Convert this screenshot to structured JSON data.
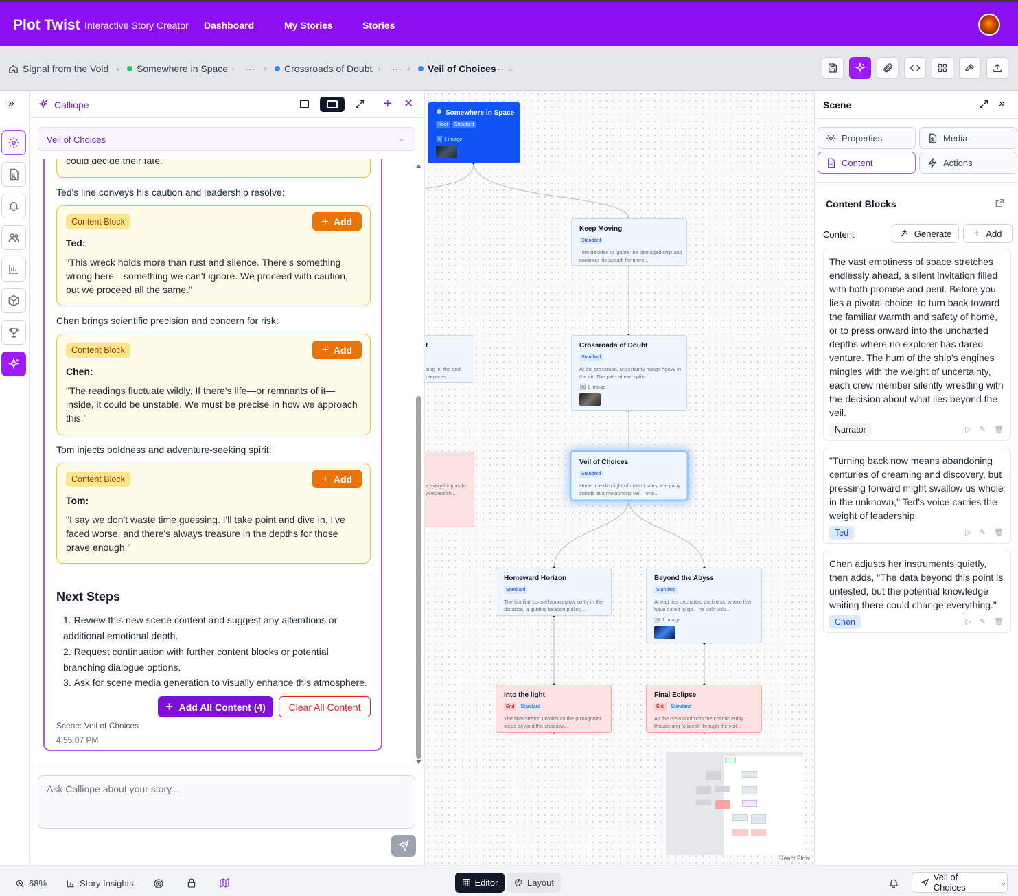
{
  "app": {
    "name": "Plot Twist",
    "tagline": "Interactive Story Creator",
    "nav": [
      "Dashboard",
      "My Stories",
      "Stories"
    ]
  },
  "breadcrumb": {
    "root": "Signal from the Void",
    "items": [
      "Somewhere in Space",
      "Crossroads of Doubt",
      "Veil of Choices"
    ],
    "ellipsis": "···"
  },
  "chat": {
    "title": "Calliope",
    "scene_select": "Veil of Choices",
    "cut_text": "could decide their fate.",
    "block_tag": "Content Block",
    "add_label": "Add",
    "blocks": [
      {
        "intro": "Ted's line conveys his caution and leadership resolve:",
        "name": "Ted:",
        "text": "\"This wreck holds more than rust and silence. There's something wrong here—something we can't ignore. We proceed with caution, but we proceed all the same.\""
      },
      {
        "intro": "Chen brings scientific precision and concern for risk:",
        "name": "Chen:",
        "text": "\"The readings fluctuate wildly. If there's life—or remnants of it—inside, it could be unstable. We must be precise in how we approach this.\""
      },
      {
        "intro": "Tom injects boldness and adventure-seeking spirit:",
        "name": "Tom:",
        "text": "\"I say we don't waste time guessing. I'll take point and dive in. I've faced worse, and there's always treasure in the depths for those brave enough.\""
      }
    ],
    "next_steps_title": "Next Steps",
    "next_steps": [
      "Review this new scene content and suggest any alterations or additional emotional depth.",
      "Request continuation with further content blocks or potential branching dialogue options.",
      "Ask for scene media generation to visually enhance this atmosphere."
    ],
    "add_all": "Add All Content (4)",
    "clear_all": "Clear All Content",
    "footer_scene": "Scene: Veil of Choices",
    "footer_time": "4:55:07 PM",
    "composer_placeholder": "Ask Calliope about your story..."
  },
  "canvas": {
    "nodes": {
      "root": {
        "title": "Somewhere in Space",
        "tags": [
          "Root",
          "Standard"
        ],
        "image": "1 image"
      },
      "keep": {
        "title": "Keep Moving",
        "tags": [
          "Standard"
        ],
        "desc": "Tom decides to ignore the damaged ship and continue his search for more..."
      },
      "cross": {
        "title": "Crossroads of Doubt",
        "tags": [
          "Standard"
        ],
        "desc": "At the crossroad, uncertainty hangs heavy in the air. The path ahead splits ...",
        "image": "1 image"
      },
      "veil": {
        "title": "Veil of Choices",
        "tags": [
          "Standard"
        ],
        "desc": "Under the dim light of distant stars, the party stands at a metaphoric veil—one..."
      },
      "home": {
        "title": "Homeward Horizon",
        "tags": [
          "Standard"
        ],
        "desc": "The familiar constellations glow softly in the distance, a guiding beacon pulling..."
      },
      "abyss": {
        "title": "Beyond the Abyss",
        "tags": [
          "Standard"
        ],
        "desc": "Ahead lies uncharted darkness, where few have dared to go. The cold void...",
        "image": "1 image"
      },
      "light": {
        "title": "Into the light",
        "tags": [
          "End",
          "Standard"
        ],
        "desc": "The final stretch unfolds as the protagonist steps beyond the shadows..."
      },
      "eclipse": {
        "title": "Final Eclipse",
        "tags": [
          "End",
          "Standard"
        ],
        "desc": "As the crew confronts the cosmic entity threatening to break through the veil..."
      },
      "partialA": {
        "title": "t",
        "desc": "sing in, the and prepares ..."
      },
      "partialB": {
        "desc": "s everything as he wrecked shi..."
      }
    },
    "attribution": "React Flow"
  },
  "scene_panel": {
    "title": "Scene",
    "tabs": [
      "Properties",
      "Media",
      "Content",
      "Actions"
    ],
    "section_title": "Content Blocks",
    "content_label": "Content",
    "generate": "Generate",
    "add": "Add",
    "cards": [
      {
        "text": "The vast emptiness of space stretches endlessly ahead, a silent invitation filled with both promise and peril. Before you lies a pivotal choice: to turn back toward the familiar warmth and safety of home, or to press onward into the uncharted depths where no explorer has dared venture. The hum of the ship's engines mingles with the weight of uncertainty, each crew member silently wrestling with the decision about what lies beyond the veil.",
        "speaker": "Narrator"
      },
      {
        "text": "\"Turning back now means abandoning centuries of dreaming and discovery, but pressing forward might swallow us whole in the unknown,\" Ted's voice carries the weight of leadership.",
        "speaker": "Ted"
      },
      {
        "text": "Chen adjusts her instruments quietly, then adds, \"The data beyond this point is untested, but the potential knowledge waiting there could change everything.\"",
        "speaker": "Chen"
      }
    ]
  },
  "bottom": {
    "zoom": "68%",
    "insights": "Story Insights",
    "editor": "Editor",
    "layout": "Layout",
    "scene_pick": "Veil of Choices"
  },
  "colors": {
    "brand": "#8b0ff0",
    "accent_orange": "#ea7307",
    "node_blue": "#1d4ed8",
    "end_red": "#fee2e2"
  }
}
